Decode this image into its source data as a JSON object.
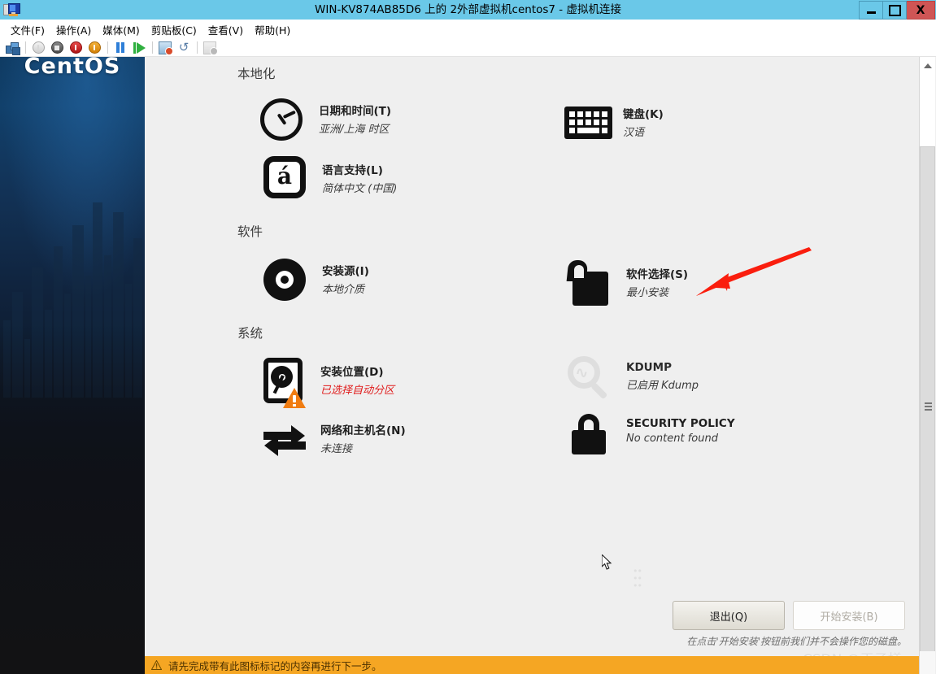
{
  "window": {
    "title": "WIN-KV874AB85D6 上的 2外部虚拟机centos7 - 虚拟机连接",
    "icon": "virtual-machine-icon",
    "controls": {
      "minimize": "—",
      "maximize": "□",
      "close": "X"
    }
  },
  "menubar": {
    "items": [
      {
        "label": "文件(F)"
      },
      {
        "label": "操作(A)"
      },
      {
        "label": "媒体(M)"
      },
      {
        "label": "剪贴板(C)"
      },
      {
        "label": "查看(V)"
      },
      {
        "label": "帮助(H)"
      }
    ]
  },
  "toolbar": {
    "buttons": [
      {
        "name": "ctrl-alt-del-icon",
        "kind": "cube"
      },
      {
        "name": "shutdown-icon",
        "kind": "power-grey"
      },
      {
        "name": "turn-off-icon",
        "kind": "stop-dark"
      },
      {
        "name": "reset-icon",
        "kind": "power-red"
      },
      {
        "name": "start-icon",
        "kind": "power-amber"
      },
      {
        "name": "pause-icon",
        "kind": "pause-blue"
      },
      {
        "name": "resume-icon",
        "kind": "play-green"
      },
      {
        "name": "checkpoint-icon",
        "kind": "film"
      },
      {
        "name": "revert-icon",
        "kind": "undo"
      },
      {
        "name": "enhanced-session-icon",
        "kind": "session-ghost"
      }
    ]
  },
  "installer": {
    "logo": "CentOS",
    "sections": [
      {
        "id": "localization",
        "title": "本地化",
        "items": [
          {
            "icon": "clock-icon",
            "title": "日期和时间(T)",
            "subtitle": "亚洲/上海 时区",
            "column": "left",
            "state": "normal"
          },
          {
            "icon": "keyboard-icon",
            "title": "键盘(K)",
            "subtitle": "汉语",
            "column": "right",
            "state": "normal"
          },
          {
            "icon": "language-icon",
            "title": "语言支持(L)",
            "subtitle": "简体中文 (中国)",
            "column": "left",
            "state": "normal"
          }
        ]
      },
      {
        "id": "software",
        "title": "软件",
        "items": [
          {
            "icon": "disc-icon",
            "title": "安装源(I)",
            "subtitle": "本地介质",
            "column": "left",
            "state": "normal"
          },
          {
            "icon": "package-icon",
            "title": "软件选择(S)",
            "subtitle": "最小安装",
            "column": "right",
            "state": "normal"
          }
        ]
      },
      {
        "id": "system",
        "title": "系统",
        "items": [
          {
            "icon": "harddisk-warning-icon",
            "title": "安装位置(D)",
            "subtitle": "已选择自动分区",
            "column": "left",
            "state": "warning"
          },
          {
            "icon": "magnifier-icon",
            "title": "KDUMP",
            "subtitle": "已启用 Kdump",
            "column": "right",
            "state": "disabled"
          },
          {
            "icon": "network-arrows-icon",
            "title": "网络和主机名(N)",
            "subtitle": "未连接",
            "column": "left",
            "state": "normal"
          },
          {
            "icon": "lock-icon",
            "title": "SECURITY POLICY",
            "subtitle": "No content found",
            "column": "right",
            "state": "normal"
          }
        ]
      }
    ],
    "footer": {
      "quit_label": "退出(Q)",
      "begin_label": "开始安装(B)",
      "begin_disabled": true,
      "note": "在点击'开始安装'按钮前我们并不会操作您的磁盘。"
    },
    "warning_bar": {
      "icon": "warning-triangle-icon",
      "text": "请先完成带有此图标标记的内容再进行下一步。"
    }
  },
  "annotation": {
    "arrow": "red-arrow-pointing-to-software-selection",
    "color": "#fa1e0e"
  },
  "watermark": {
    "text": "CSDN @王子様~"
  },
  "colors": {
    "titlebar": "#6ac8e8",
    "close_button": "#cf5555",
    "pane_background": "#efefef",
    "warning_bar": "#f5a623",
    "warning_text": "#e01b1b",
    "warning_triangle": "#f07c11"
  }
}
